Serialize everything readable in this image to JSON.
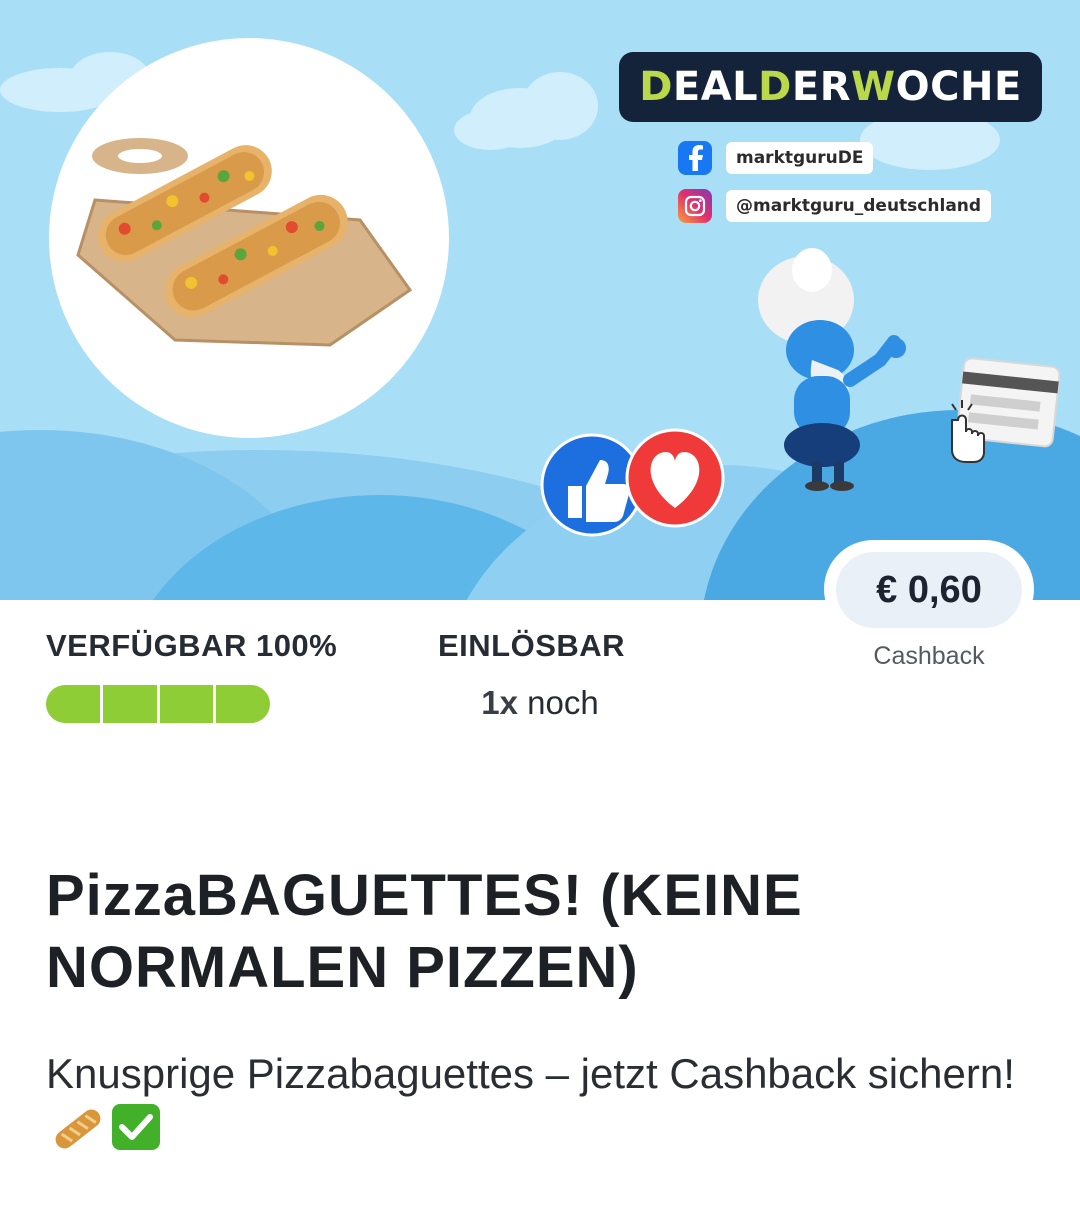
{
  "banner": {
    "deal_parts": [
      "D",
      "EAL ",
      "D",
      "ER ",
      "W",
      "OCHE"
    ],
    "facebook_handle": "marktguruDE",
    "instagram_handle": "@marktguru_deutschland",
    "icons": [
      "facebook-icon",
      "instagram-icon",
      "like-thumb-icon",
      "heart-reaction-icon",
      "tap-hand-icon",
      "card-icon"
    ],
    "colors": {
      "sky": "#a9def7",
      "hill": "#59b6e8",
      "badge": "#15233a",
      "badge_accent": "#b9d94a",
      "like": "#1d6fe0",
      "heart": "#f03a3a"
    }
  },
  "price": {
    "amount": "€ 0,60",
    "label": "Cashback"
  },
  "availability": {
    "label": "VERFÜGBAR 100%",
    "level": 1.0,
    "segments": 4,
    "color": "#8fcd36"
  },
  "redeemable": {
    "label": "EINLÖSBAR",
    "count": "1x",
    "suffix": "noch"
  },
  "offer": {
    "title": "PizzaBAGUETTES! (KEINE NORMALEN PIZZEN)",
    "description": "Knusprige Pizzabaguettes – jetzt Cashback sichern!",
    "emojis": [
      "baguette-emoji",
      "check-mark-emoji"
    ]
  }
}
